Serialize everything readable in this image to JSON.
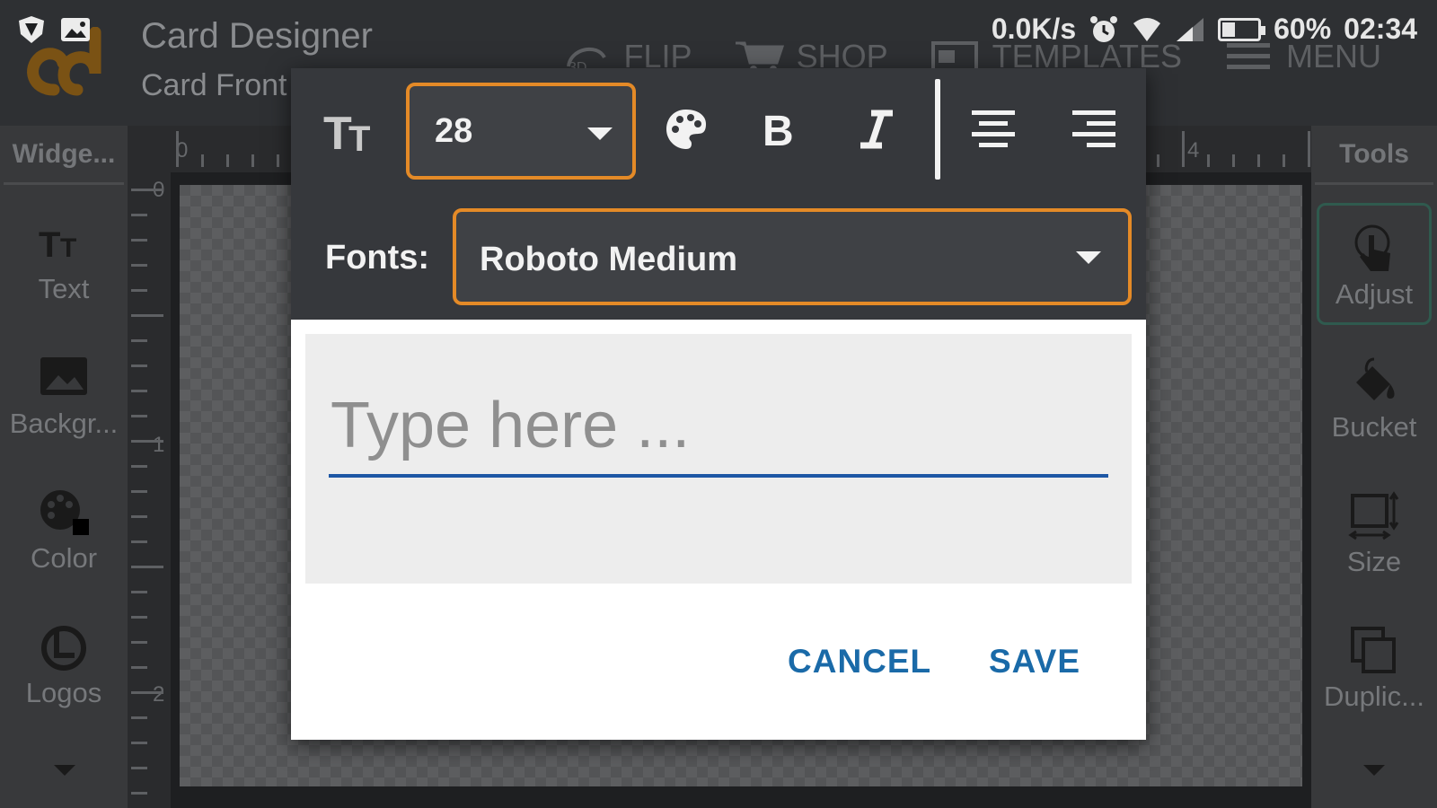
{
  "status_bar": {
    "net_speed": "0.0K/s",
    "battery": "60%",
    "time": "02:34"
  },
  "app_bar": {
    "title": "Card Designer",
    "subtitle": "Card Front",
    "actions": [
      {
        "label": "FLIP",
        "icon": "flip-3d-icon"
      },
      {
        "label": "SHOP",
        "icon": "cart-icon"
      },
      {
        "label": "TEMPLATES",
        "icon": "templates-icon"
      },
      {
        "label": "MENU",
        "icon": "hamburger-icon"
      }
    ]
  },
  "left_panel": {
    "header": "Widge...",
    "items": [
      {
        "label": "Text",
        "icon": "text-icon"
      },
      {
        "label": "Backgr...",
        "icon": "image-icon"
      },
      {
        "label": "Color",
        "icon": "palette-icon"
      },
      {
        "label": "Logos",
        "icon": "logos-icon"
      }
    ]
  },
  "right_panel": {
    "header": "Tools",
    "items": [
      {
        "label": "Adjust",
        "icon": "touch-icon"
      },
      {
        "label": "Bucket",
        "icon": "bucket-icon"
      },
      {
        "label": "Size",
        "icon": "resize-icon"
      },
      {
        "label": "Duplic...",
        "icon": "duplicate-icon"
      }
    ]
  },
  "rulers": {
    "horizontal": [
      "0",
      "4"
    ],
    "vertical": [
      "0",
      "1",
      "2"
    ]
  },
  "dialog": {
    "font_size": "28",
    "fonts_label": "Fonts:",
    "font_name": "Roboto Medium",
    "text_placeholder": "Type here ...",
    "text_value": "",
    "cancel_label": "CANCEL",
    "save_label": "SAVE",
    "colors": {
      "toolbar_bg": "#36383c",
      "select_border": "#e48a27",
      "action_text": "#1a6aa8",
      "input_underline": "#1e57a5"
    }
  }
}
